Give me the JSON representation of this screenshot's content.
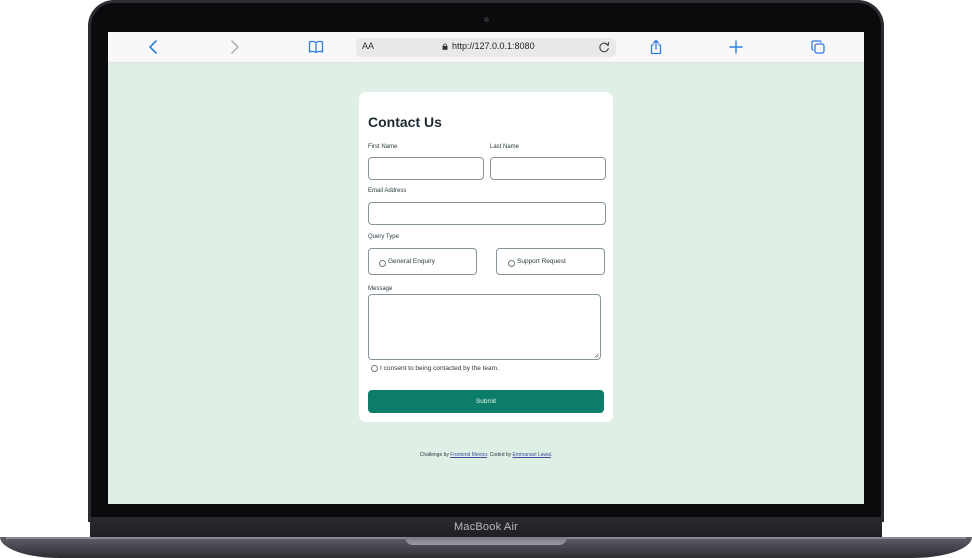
{
  "device": {
    "brand_label": "MacBook Air"
  },
  "browser": {
    "text_size_label": "AA",
    "url": "http://127.0.0.1:8080"
  },
  "form": {
    "title": "Contact Us",
    "first_name_label": "First Name",
    "last_name_label": "Last Name",
    "email_label": "Email Address",
    "query_type_label": "Query Type",
    "query_options": [
      "General Enquiry",
      "Support Request"
    ],
    "message_label": "Message",
    "consent_label": "I consent to being contacted by the team.",
    "submit_label": "Submit",
    "first_name_value": "",
    "last_name_value": "",
    "email_value": "",
    "message_value": ""
  },
  "footer": {
    "prefix": "Challenge by ",
    "challenge_link": "Frontend Mentor",
    "middle": ". Coded by ",
    "author_link": "Emmanuel Lawal",
    "suffix": "."
  },
  "colors": {
    "page_background": "#dfefe5",
    "accent": "#0c7d69",
    "link": "#3f4e9d",
    "browser_icon": "#2f7de1"
  }
}
